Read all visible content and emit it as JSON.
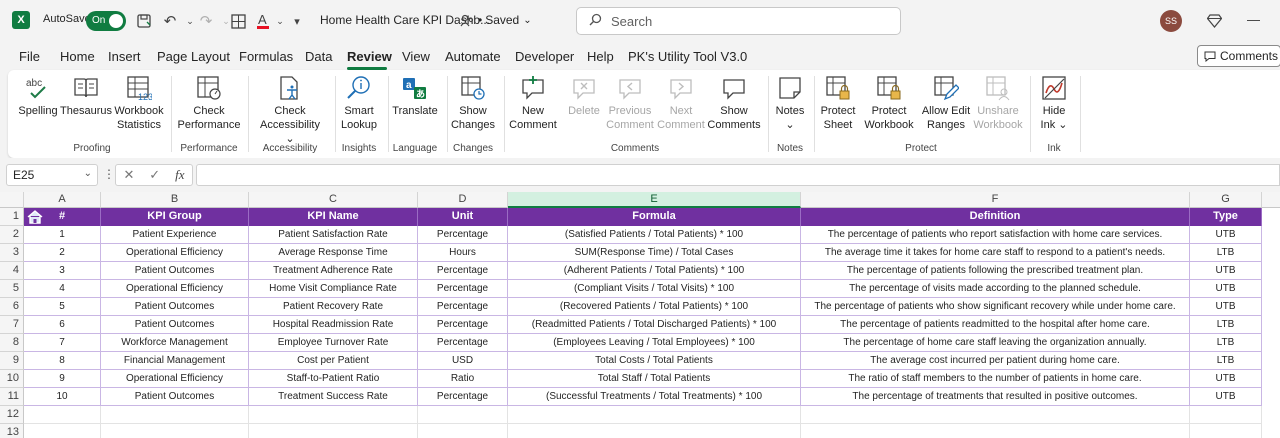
{
  "app": {
    "logo_letter": "X",
    "autosave_label": "AutoSave",
    "autosave_state": "On",
    "document_title": "Home Health Care KPI Dashb...",
    "save_status": "Saved",
    "search_placeholder": "Search",
    "user_initials": "SS",
    "brand_color": "#107c41"
  },
  "menu": {
    "items": [
      "File",
      "Home",
      "Insert",
      "Page Layout",
      "Formulas",
      "Data",
      "Review",
      "View",
      "Automate",
      "Developer",
      "Help",
      "PK's Utility Tool V3.0"
    ],
    "active": "Review",
    "comments_button": "Comments"
  },
  "ribbon": {
    "groups": {
      "proofing": "Proofing",
      "performance": "Performance",
      "accessibility": "Accessibility",
      "insights": "Insights",
      "language": "Language",
      "changes": "Changes",
      "comments": "Comments",
      "notes": "Notes",
      "protect": "Protect",
      "ink": "Ink"
    },
    "buttons": {
      "spelling": "Spelling",
      "thesaurus": "Thesaurus",
      "workbook_statistics_1": "Workbook",
      "workbook_statistics_2": "Statistics",
      "check_performance_1": "Check",
      "check_performance_2": "Performance",
      "check_accessibility_1": "Check",
      "check_accessibility_2": "Accessibility",
      "smart_lookup_1": "Smart",
      "smart_lookup_2": "Lookup",
      "translate": "Translate",
      "show_changes_1": "Show",
      "show_changes_2": "Changes",
      "new_comment_1": "New",
      "new_comment_2": "Comment",
      "delete": "Delete",
      "previous_comment_1": "Previous",
      "previous_comment_2": "Comment",
      "next_comment_1": "Next",
      "next_comment_2": "Comment",
      "show_comments_1": "Show",
      "show_comments_2": "Comments",
      "notes": "Notes",
      "protect_sheet_1": "Protect",
      "protect_sheet_2": "Sheet",
      "protect_workbook_1": "Protect",
      "protect_workbook_2": "Workbook",
      "allow_edit_ranges_1": "Allow Edit",
      "allow_edit_ranges_2": "Ranges",
      "unshare_workbook_1": "Unshare",
      "unshare_workbook_2": "Workbook",
      "hide_ink_1": "Hide",
      "hide_ink_2": "Ink"
    }
  },
  "formula_bar": {
    "name_box": "E25",
    "fx": "fx",
    "formula": ""
  },
  "sheet": {
    "columns": [
      "A",
      "B",
      "C",
      "D",
      "E",
      "F",
      "G"
    ],
    "selected_column": "E",
    "rows": [
      "1",
      "2",
      "3",
      "4",
      "5",
      "6",
      "7",
      "8",
      "9",
      "10",
      "11",
      "12",
      "13"
    ],
    "header_color": "#7030a0",
    "table_headers": [
      "#",
      "KPI Group",
      "KPI Name",
      "Unit",
      "Formula",
      "Definition",
      "Type"
    ],
    "table_rows": [
      [
        "1",
        "Patient Experience",
        "Patient Satisfaction Rate",
        "Percentage",
        "(Satisfied Patients / Total Patients) * 100",
        "The percentage of patients who report satisfaction with home care services.",
        "UTB"
      ],
      [
        "2",
        "Operational Efficiency",
        "Average Response Time",
        "Hours",
        "SUM(Response Time) / Total Cases",
        "The average time it takes for home care staff to respond to a patient's needs.",
        "LTB"
      ],
      [
        "3",
        "Patient Outcomes",
        "Treatment Adherence Rate",
        "Percentage",
        "(Adherent Patients / Total Patients) * 100",
        "The percentage of patients following the prescribed treatment plan.",
        "UTB"
      ],
      [
        "4",
        "Operational Efficiency",
        "Home Visit Compliance Rate",
        "Percentage",
        "(Compliant Visits / Total Visits) * 100",
        "The percentage of visits made according to the planned schedule.",
        "UTB"
      ],
      [
        "5",
        "Patient Outcomes",
        "Patient Recovery Rate",
        "Percentage",
        "(Recovered Patients / Total Patients) * 100",
        "The percentage of patients who show significant recovery while under home care.",
        "UTB"
      ],
      [
        "6",
        "Patient Outcomes",
        "Hospital Readmission Rate",
        "Percentage",
        "(Readmitted Patients / Total Discharged Patients) * 100",
        "The percentage of patients readmitted to the hospital after home care.",
        "LTB"
      ],
      [
        "7",
        "Workforce Management",
        "Employee Turnover Rate",
        "Percentage",
        "(Employees Leaving / Total Employees) * 100",
        "The percentage of home care staff leaving the organization annually.",
        "LTB"
      ],
      [
        "8",
        "Financial Management",
        "Cost per Patient",
        "USD",
        "Total Costs / Total Patients",
        "The average cost incurred per patient during home care.",
        "LTB"
      ],
      [
        "9",
        "Operational Efficiency",
        "Staff-to-Patient Ratio",
        "Ratio",
        "Total Staff / Total Patients",
        "The ratio of staff members to the number of patients in home care.",
        "UTB"
      ],
      [
        "10",
        "Patient Outcomes",
        "Treatment Success Rate",
        "Percentage",
        "(Successful Treatments / Total Treatments) * 100",
        "The percentage of treatments that resulted in positive outcomes.",
        "UTB"
      ]
    ]
  }
}
